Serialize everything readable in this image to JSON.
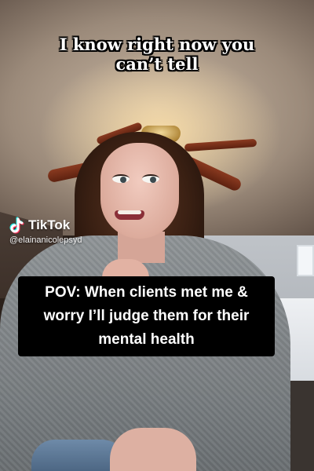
{
  "caption_top": {
    "line1": "I know right now you",
    "line2": "can’t tell"
  },
  "watermark": {
    "brand": "TikTok",
    "handle": "@elainanicolepsyd",
    "icon": "tiktok-logo-icon"
  },
  "caption_pov": {
    "line1": "POV: When clients met me &",
    "line2": "worry I’ll judge them for their",
    "line3": "mental health"
  },
  "colors": {
    "caption_text": "#ffffff",
    "caption_outline": "#000000",
    "pov_background": "#000000",
    "tiktok_cyan": "#25f4ee",
    "tiktok_red": "#fe2c55"
  }
}
